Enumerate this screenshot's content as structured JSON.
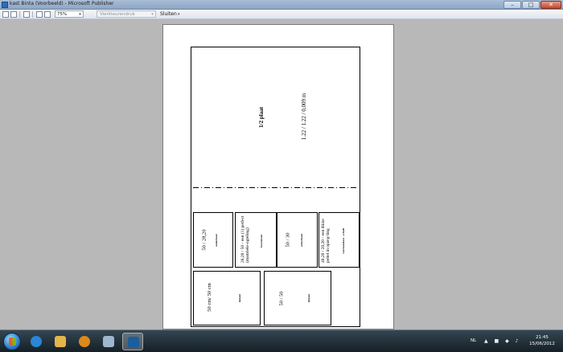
{
  "window": {
    "title": "kast Binta (Voorbeeld) - Microsoft Publisher",
    "minimize_glyph": "–",
    "maximize_glyph": "□",
    "close_glyph": "✕"
  },
  "toolbar": {
    "zoom_value": "75%",
    "print_mode_placeholder": "Vierkleurendruk",
    "close_preview_label": "Sluiten",
    "dropdown_glyph": "▾",
    "icons": [
      "single-page-icon",
      "multi-page-icon",
      "print-icon",
      "zoom-in-icon",
      "zoom-out-icon"
    ]
  },
  "document": {
    "plaat_title": "1/2 plaat",
    "plaat_dims": "1.22 / 1.22 / 0,009 m",
    "pieces": [
      {
        "label": "50 / 28,20",
        "tag": "onderkant"
      },
      {
        "label": "28,20 / 50 - een (1) petfect (mambele-ogteling)",
        "tag": "bovenkant"
      },
      {
        "label": "50 / 30",
        "tag": "achterkant"
      },
      {
        "label": "48,20 / 28,20 - een dikke peltel in opzeg-ling",
        "tag": "voorkantkast - schuif"
      },
      {
        "label": "50 cm/ 50 cm",
        "tag": "zijkant"
      },
      {
        "label": "50 / 50",
        "tag": "zijkant"
      }
    ]
  },
  "taskbar": {
    "apps": [
      "windows-explorer",
      "internet-explorer",
      "file-explorer",
      "media-player",
      "window-manager",
      "publisher"
    ],
    "language": "NL",
    "tray_glyphs": "▲ ■ ◆ ♪",
    "time": "21:45",
    "date": "15/06/2012"
  }
}
